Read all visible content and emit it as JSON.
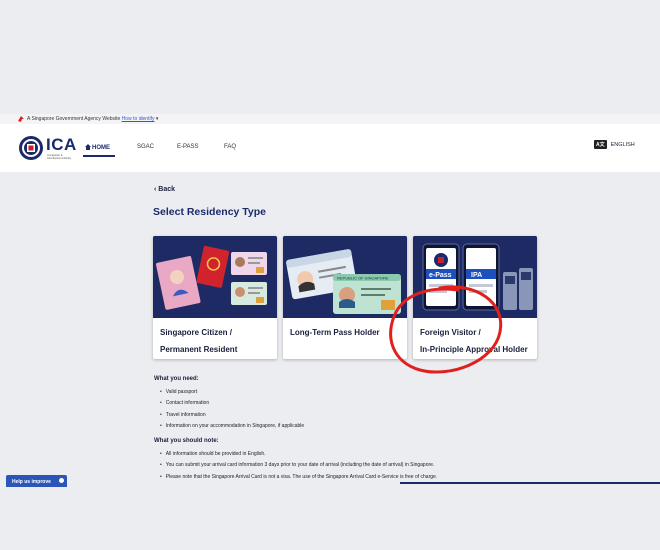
{
  "gov_banner": {
    "text": "A Singapore Government Agency Website",
    "link": "How to identify",
    "chevron": "▾"
  },
  "header": {
    "logo_text": "ICA",
    "logo_sub": "Immigration & Checkpoints Authority",
    "nav": {
      "home": "HOME",
      "sgac": "SGAC",
      "epass": "E-PASS",
      "faq": "FAQ"
    },
    "language": "ENGLISH"
  },
  "main": {
    "back_label": "Back",
    "title": "Select Residency Type",
    "cards": [
      {
        "line1": "Singapore Citizen /",
        "line2": "Permanent Resident"
      },
      {
        "line1": "Long-Term Pass Holder",
        "line2": ""
      },
      {
        "line1": "Foreign Visitor /",
        "line2": "In-Principle Approval Holder"
      }
    ],
    "card3_img": {
      "epass": "e-Pass",
      "ipa": "IPA"
    },
    "card2_img": {
      "header": "REPUBLIC OF SINGAPORE"
    },
    "need_title": "What you need:",
    "need_items": [
      "Valid passport",
      "Contact information",
      "Travel information",
      "Information on your accommodation in Singapore, if applicable"
    ],
    "note_title": "What you should note:",
    "note_items": [
      "All information should be provided in English.",
      "You can submit your arrival card information 3 days prior to your date of arrival (including the date of arrival) in Singapore.",
      "Please note that the Singapore Arrival Card is not a visa. The use of the Singapore Arrival Card e-Service is free of charge."
    ]
  },
  "help": {
    "label": "Help us improve"
  },
  "colors": {
    "navy": "#1b2a6b",
    "annotation": "#e0201c",
    "background": "#ecedf1"
  },
  "icons": [
    "lion-head-icon",
    "ica-crest-icon",
    "home-icon",
    "language-icon",
    "chevron-left-icon",
    "chat-icon"
  ]
}
